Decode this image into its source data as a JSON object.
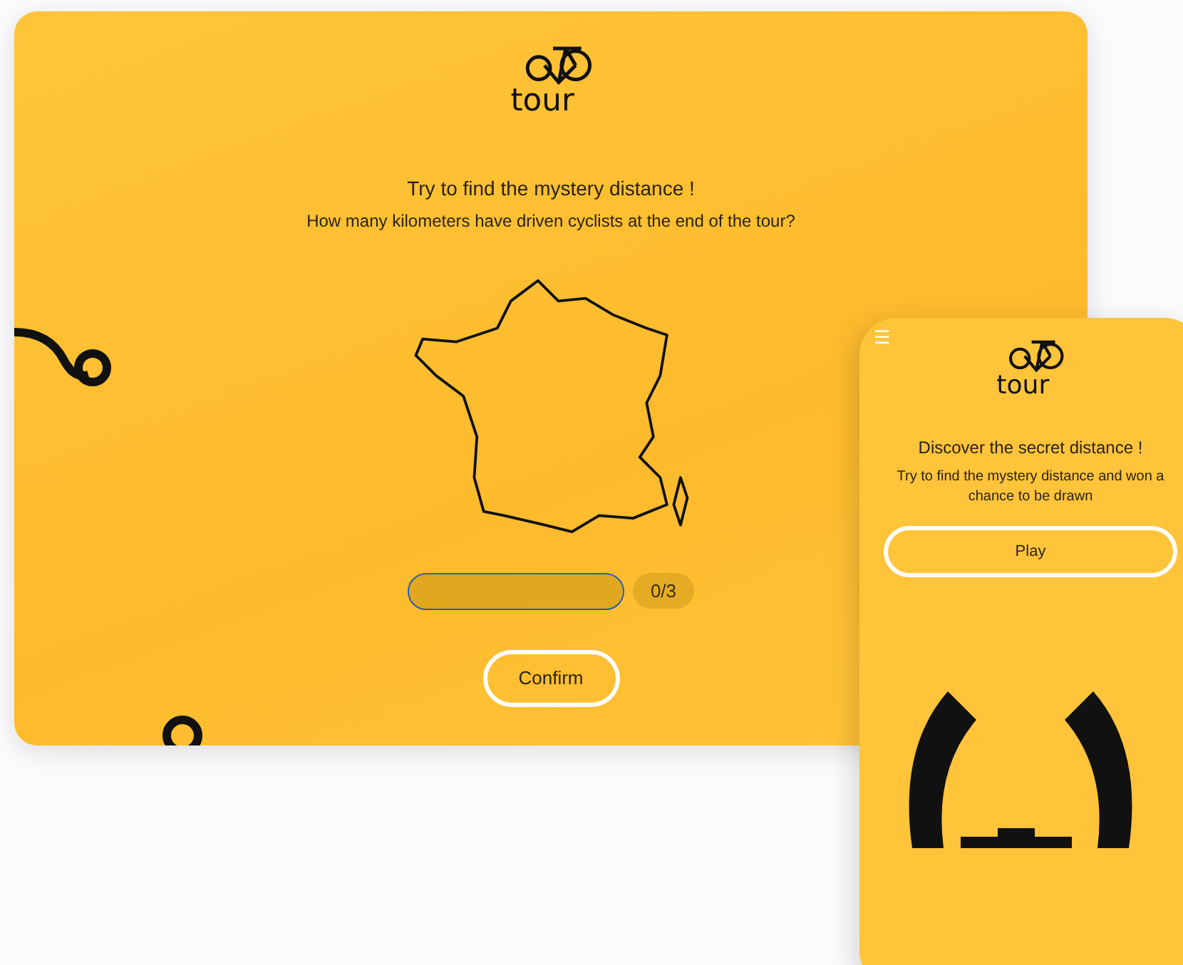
{
  "desktop": {
    "logo_text": "tour",
    "title": "Try to find the mystery distance !",
    "question": "How many kilometers have driven cyclists at the end of the tour?",
    "attempts": "0/3",
    "confirm_button": "Confirm"
  },
  "mobile": {
    "menu_icon": "☰",
    "logo_text": "tour",
    "title": "Discover the secret distance !",
    "subtitle": "Try to find the mystery distance and won a chance to be drawn",
    "play_button": "Play"
  }
}
